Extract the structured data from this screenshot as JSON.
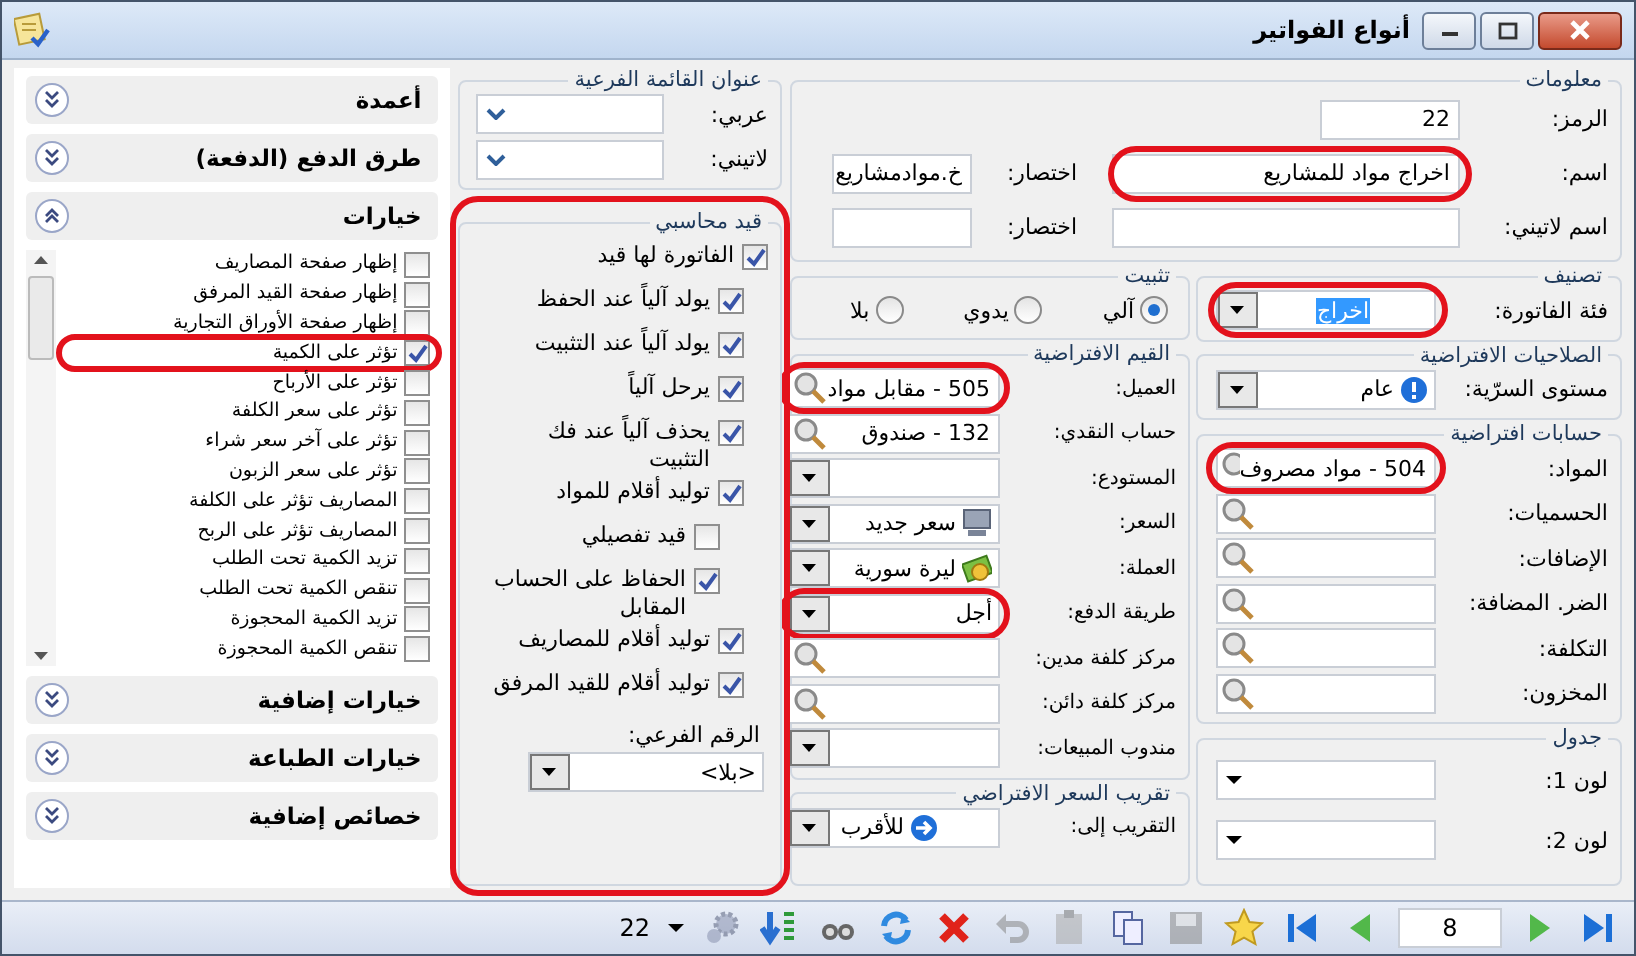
{
  "window": {
    "title": "أنواع الفواتير"
  },
  "info": {
    "legend": "معلومات",
    "code": {
      "label": "الرمز:",
      "value": "22"
    },
    "name": {
      "label": "اسم:",
      "value": "اخراج مواد للمشاريع",
      "highlighted": true
    },
    "abbr": {
      "label": "اختصار:",
      "value": "خ.موادمشاريع"
    },
    "latin_name": {
      "label": "اسم لاتيني:"
    },
    "latin_abbr": {
      "label": "اختصار:"
    }
  },
  "classification": {
    "legend": "تصنيف",
    "label": "فئة الفاتورة:",
    "value": "اخراج",
    "highlighted": true
  },
  "permissions": {
    "legend": "الصلاحيات الافتراضية",
    "label": "مستوى السرّية:",
    "value": "عام"
  },
  "accounts": {
    "legend": "حسابات افتراضية",
    "fields": [
      {
        "label": "المواد:",
        "value": "504 - مواد مصروف",
        "highlighted": true
      },
      {
        "label": "الحسميات:",
        "highlighted": false
      },
      {
        "label": "الإضافات:",
        "highlighted": false
      },
      {
        "label": "الضر. المضافة:",
        "highlighted": false
      },
      {
        "label": "التكلفة:",
        "highlighted": false
      },
      {
        "label": "المخزون:",
        "highlighted": false
      }
    ]
  },
  "grid_table": {
    "legend": "جدول",
    "fields": [
      {
        "label": "لون 1:"
      },
      {
        "label": "لون 2:"
      }
    ]
  },
  "posting": {
    "legend": "تثبيت",
    "options": [
      {
        "label": "آلي",
        "selected": true
      },
      {
        "label": "يدوي",
        "selected": false
      },
      {
        "label": "بلا",
        "selected": false
      }
    ]
  },
  "defaults": {
    "legend": "القيم الافتراضية",
    "fields": [
      {
        "kind": "lookup",
        "label": "العميل:",
        "value": "505 - مقابل مواد",
        "highlighted": true
      },
      {
        "kind": "lookup",
        "label": "حساب النقدي:",
        "value": "132 - صندوق",
        "highlighted": false
      },
      {
        "kind": "dropdown",
        "label": "المستودع:",
        "highlighted": false
      },
      {
        "kind": "price",
        "label": "السعر:",
        "value": "سعر جديد",
        "highlighted": false
      },
      {
        "kind": "currency",
        "label": "العملة:",
        "value": "ليرة سورية",
        "highlighted": false
      },
      {
        "kind": "dropdown",
        "label": "طريقة الدفع:",
        "value": "أجل",
        "highlighted": true
      },
      {
        "kind": "lookup",
        "label": "مركز كلفة مدين:",
        "highlighted": false
      },
      {
        "kind": "lookup",
        "label": "مركز كلفة دائن:",
        "highlighted": false
      },
      {
        "kind": "dropdown",
        "label": "مندوب المبيعات:",
        "highlighted": false
      }
    ]
  },
  "rounding": {
    "legend": "تقريب السعر الافتراضي",
    "label": "التقريب إلى:",
    "value": "للأقرب"
  },
  "submenu": {
    "legend": "عنوان القائمة الفرعية",
    "fields": [
      {
        "label": "عربي:"
      },
      {
        "label": "لاتيني:"
      }
    ]
  },
  "journal": {
    "legend": "قيد محاسبي",
    "highlighted": true,
    "options": [
      {
        "label": "الفاتورة لها قيد",
        "checked": true,
        "children": [
          {
            "label": "يولد آلياً عند الحفظ",
            "checked": true
          },
          {
            "label": "يولد آلياً عند التثبيت",
            "checked": true
          },
          {
            "label": "يرحل آلياً",
            "checked": true
          },
          {
            "label": "يحذف آلياً عند فك التثبيت",
            "checked": true
          },
          {
            "label": "توليد أقلام للمواد",
            "checked": true,
            "children": [
              {
                "label": "قيد تفصيلي",
                "checked": false
              },
              {
                "label": "الحفاظ على الحساب المقابل",
                "checked": true
              }
            ]
          },
          {
            "label": "توليد أقلام للمصاريف",
            "checked": true
          },
          {
            "label": "توليد أقلام للقيد المرفق",
            "checked": true
          }
        ]
      }
    ],
    "branch": {
      "label": "الرقم الفرعي:",
      "value": "<بلا>"
    }
  },
  "sidebar": {
    "sections": [
      {
        "title": "أعمدة",
        "expanded": false
      },
      {
        "title": "طرق الدفع (الدفعة)",
        "expanded": false
      },
      {
        "title": "خيارات",
        "expanded": true,
        "items": [
          {
            "label": "إظهار صفحة المصاريف",
            "checked": false,
            "highlighted": false
          },
          {
            "label": "إظهار صفحة القيد المرفق",
            "checked": false,
            "highlighted": false
          },
          {
            "label": "إظهار صفحة الأوراق التجارية",
            "checked": false,
            "highlighted": false
          },
          {
            "label": "تؤثر على الكمية",
            "checked": true,
            "highlighted": true
          },
          {
            "label": "تؤثر على الأرباح",
            "checked": false,
            "highlighted": false
          },
          {
            "label": "تؤثر على سعر الكلفة",
            "checked": false,
            "highlighted": false
          },
          {
            "label": "تؤثر على آخر سعر شراء",
            "checked": false,
            "highlighted": false
          },
          {
            "label": "تؤثر على سعر الزبون",
            "checked": false,
            "highlighted": false
          },
          {
            "label": "المصاريف تؤثر على الكلفة",
            "checked": false,
            "highlighted": false
          },
          {
            "label": "المصاريف تؤثر على الربح",
            "checked": false,
            "highlighted": false
          },
          {
            "label": "تزيد الكمية تحت الطلب",
            "checked": false,
            "highlighted": false
          },
          {
            "label": "تنقص الكمية تحت الطلب",
            "checked": false,
            "highlighted": false
          },
          {
            "label": "تزيد الكمية المحجوزة",
            "checked": false,
            "highlighted": false
          },
          {
            "label": "تنقص الكمية المحجوزة",
            "checked": false,
            "highlighted": false
          }
        ]
      },
      {
        "title": "خيارات إضافية",
        "expanded": false
      },
      {
        "title": "خيارات الطباعة",
        "expanded": false
      },
      {
        "title": "خصائص إضافية",
        "expanded": false
      }
    ]
  },
  "status_bar": {
    "record": "22",
    "page": "8",
    "tools": [
      {
        "kind": "settings",
        "disabled": true
      },
      {
        "kind": "sort",
        "disabled": false
      },
      {
        "kind": "find",
        "disabled": false
      },
      {
        "kind": "refresh",
        "disabled": false
      },
      {
        "kind": "delete",
        "disabled": false
      },
      {
        "kind": "undo",
        "disabled": true
      },
      {
        "kind": "paste",
        "disabled": true
      },
      {
        "kind": "copy",
        "disabled": false
      },
      {
        "kind": "save",
        "disabled": true
      },
      {
        "kind": "favorite",
        "disabled": false
      }
    ]
  }
}
